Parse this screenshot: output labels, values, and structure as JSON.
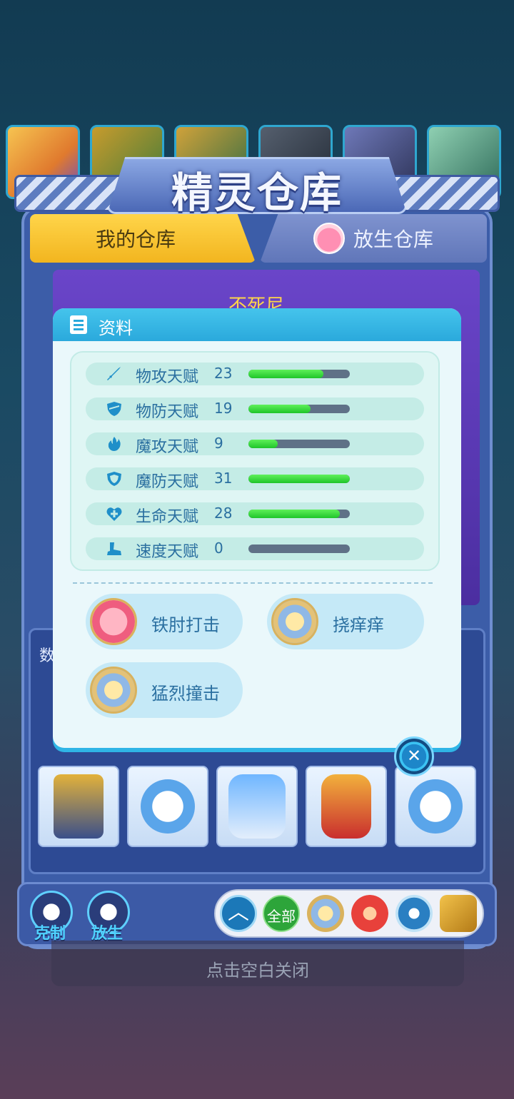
{
  "panel": {
    "title": "精灵仓库",
    "tabs": {
      "mine": "我的仓库",
      "release": "放生仓库"
    },
    "pet_name_partial": "不死尼"
  },
  "dialog": {
    "title": "资料",
    "talents": [
      {
        "name": "物攻天赋",
        "value": "23",
        "level": 0.74,
        "icon": "sword-icon"
      },
      {
        "name": "物防天赋",
        "value": "19",
        "level": 0.61,
        "icon": "shield-icon"
      },
      {
        "name": "魔攻天赋",
        "value": "9",
        "level": 0.29,
        "icon": "fire-icon"
      },
      {
        "name": "魔防天赋",
        "value": "31",
        "level": 1.0,
        "icon": "magic-shield-icon"
      },
      {
        "name": "生命天赋",
        "value": "28",
        "level": 0.9,
        "icon": "heart-plus-icon"
      },
      {
        "name": "速度天赋",
        "value": "0",
        "level": 0.0,
        "icon": "boot-icon"
      }
    ],
    "skills": [
      {
        "name": "铁肘打击",
        "icon": "fist-skill-icon"
      },
      {
        "name": "挠痒痒",
        "icon": "normal-skill-icon"
      },
      {
        "name": "猛烈撞击",
        "icon": "normal-skill-icon"
      }
    ]
  },
  "bottom": {
    "counter_label": "克制",
    "release_label": "放生",
    "filter_all": "全部"
  },
  "close_hint": "点击空白关闭",
  "grid_partial_label": "数"
}
